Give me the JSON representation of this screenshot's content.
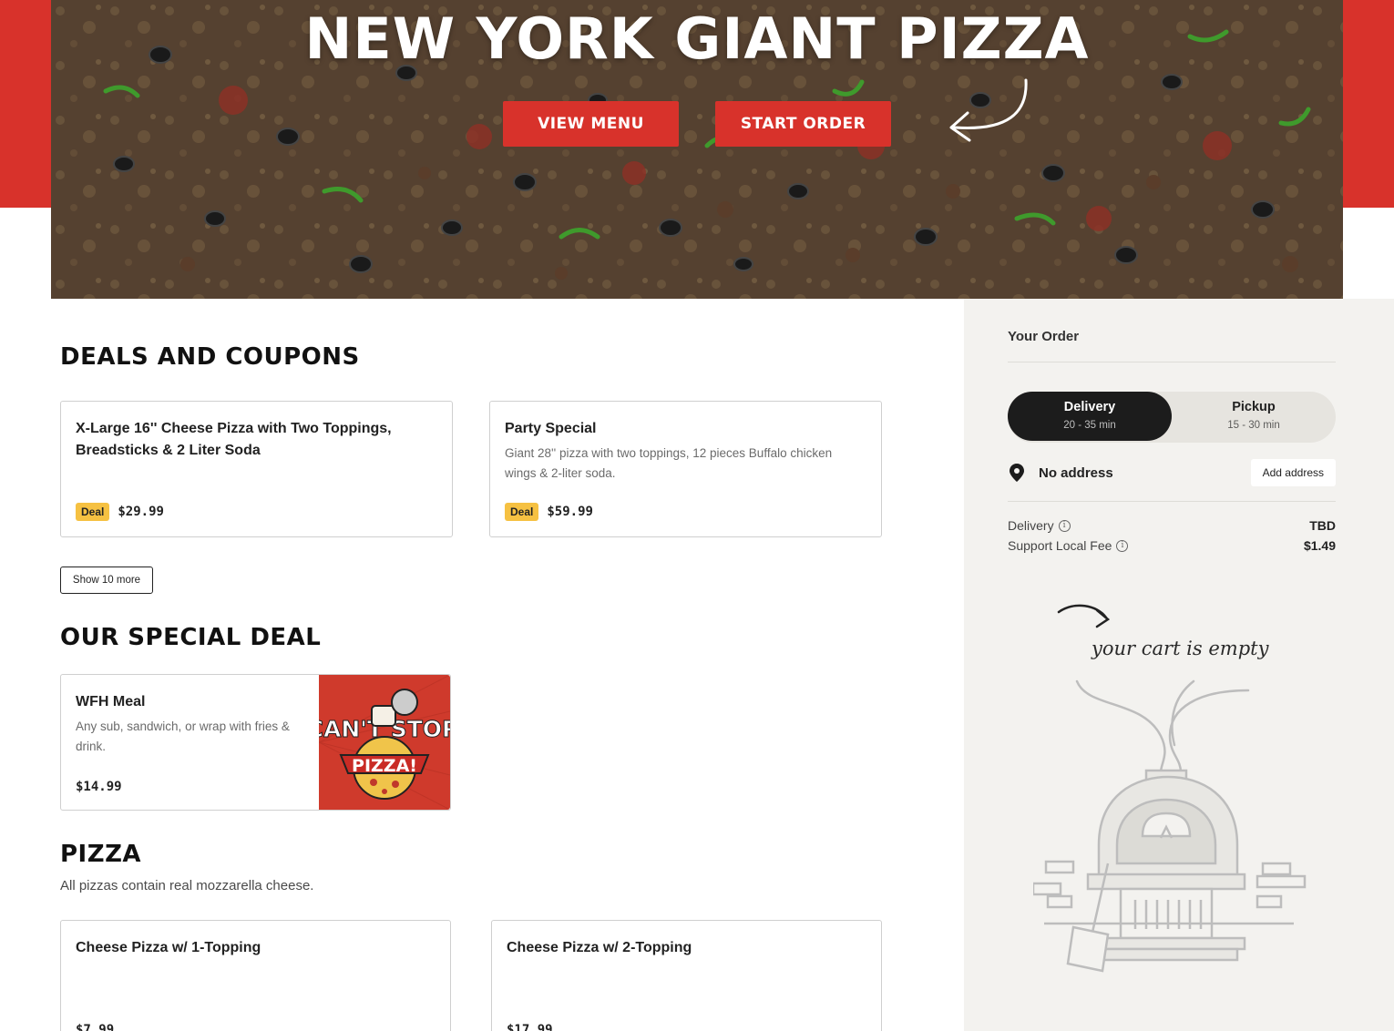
{
  "hero": {
    "title": "NEW YORK GIANT PIZZA",
    "view_menu_label": "VIEW MENU",
    "start_order_label": "START ORDER"
  },
  "deals": {
    "title": "DEALS AND COUPONS",
    "items": [
      {
        "title": "X-Large 16'' Cheese Pizza with Two Toppings, Breadsticks & 2 Liter Soda",
        "description": "",
        "badge": "Deal",
        "price": "$29.99"
      },
      {
        "title": "Party Special",
        "description": "Giant 28'' pizza with two toppings, 12 pieces Buffalo chicken wings & 2-liter soda.",
        "badge": "Deal",
        "price": "$59.99"
      }
    ],
    "show_more_label": "Show 10 more"
  },
  "special": {
    "title": "OUR SPECIAL DEAL",
    "item": {
      "title": "WFH Meal",
      "description": "Any sub, sandwich, or wrap with fries & drink.",
      "price": "$14.99",
      "image_text_1": "CAN'T STOP",
      "image_text_2": "PIZZA!"
    }
  },
  "pizza": {
    "title": "PIZZA",
    "subtitle": "All pizzas contain real mozzarella cheese.",
    "items": [
      {
        "title": "Cheese Pizza w/ 1-Topping",
        "price": "$7.99"
      },
      {
        "title": "Cheese Pizza w/ 2-Topping",
        "price": "$17.99"
      }
    ]
  },
  "order": {
    "title": "Your Order",
    "delivery_label": "Delivery",
    "delivery_time": "20 - 35 min",
    "pickup_label": "Pickup",
    "pickup_time": "15 - 30 min",
    "address_text": "No address",
    "add_address_label": "Add address",
    "fees": [
      {
        "label": "Delivery",
        "value": "TBD"
      },
      {
        "label": "Support Local Fee",
        "value": "$1.49"
      }
    ],
    "empty_text": "your cart is empty"
  },
  "colors": {
    "brand_red": "#d8322b",
    "deal_yellow": "#f6c142",
    "sidebar_bg": "#f3f2ef",
    "dark": "#1c1c1c"
  }
}
